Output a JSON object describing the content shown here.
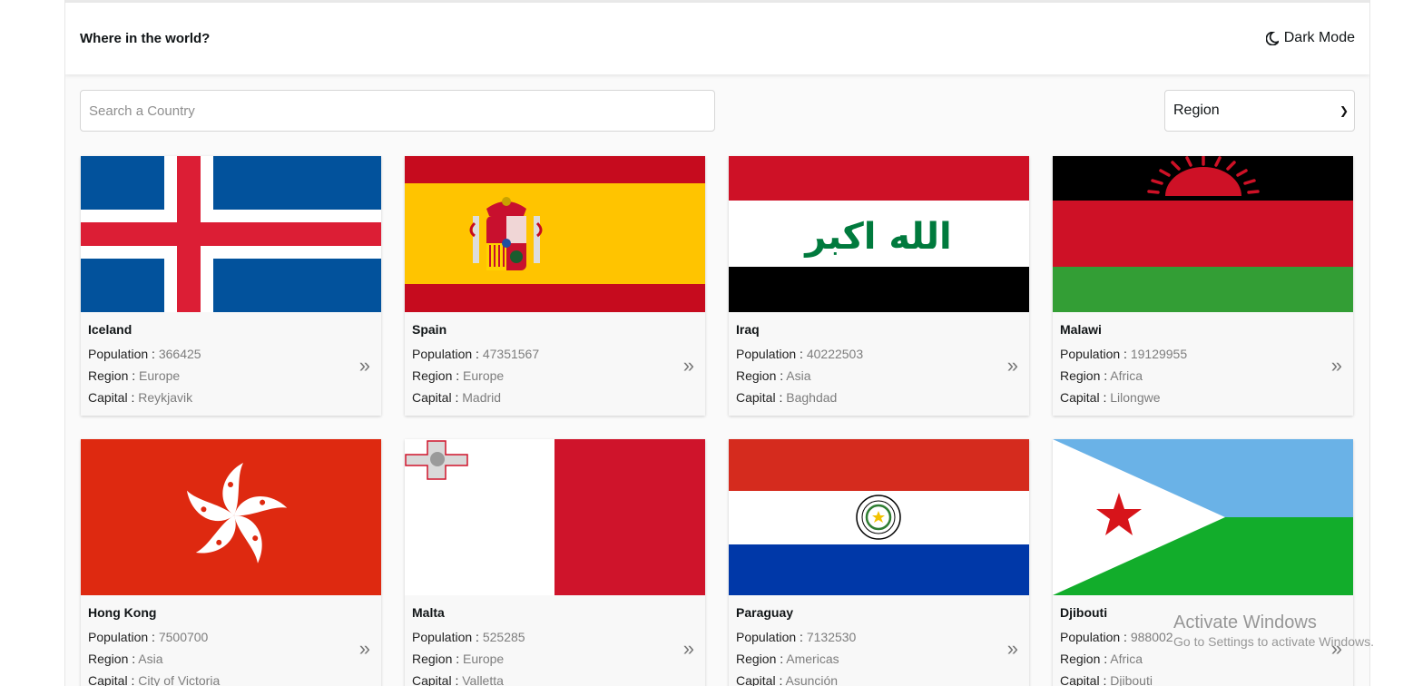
{
  "header": {
    "title": "Where in the world?",
    "dark_mode_label": "Dark Mode"
  },
  "search": {
    "placeholder": "Search a Country",
    "value": ""
  },
  "filter": {
    "selected": "Region"
  },
  "labels": {
    "population": "Population : ",
    "region": "Region : ",
    "capital": "Capital : "
  },
  "countries": [
    {
      "name": "Iceland",
      "population": "366425",
      "region": "Europe",
      "capital": "Reykjavik"
    },
    {
      "name": "Spain",
      "population": "47351567",
      "region": "Europe",
      "capital": "Madrid"
    },
    {
      "name": "Iraq",
      "population": "40222503",
      "region": "Asia",
      "capital": "Baghdad"
    },
    {
      "name": "Malawi",
      "population": "19129955",
      "region": "Africa",
      "capital": "Lilongwe"
    },
    {
      "name": "Hong Kong",
      "population": "7500700",
      "region": "Asia",
      "capital": "City of Victoria"
    },
    {
      "name": "Malta",
      "population": "525285",
      "region": "Europe",
      "capital": "Valletta"
    },
    {
      "name": "Paraguay",
      "population": "7132530",
      "region": "Americas",
      "capital": "Asunción"
    },
    {
      "name": "Djibouti",
      "population": "988002",
      "region": "Africa",
      "capital": "Djibouti"
    }
  ],
  "iraq_flag_text": "الله اكبر",
  "more_icon": "double-chevron-right-icon",
  "watermark": {
    "title": "Activate Windows",
    "subtitle": "Go to Settings to activate Windows."
  }
}
